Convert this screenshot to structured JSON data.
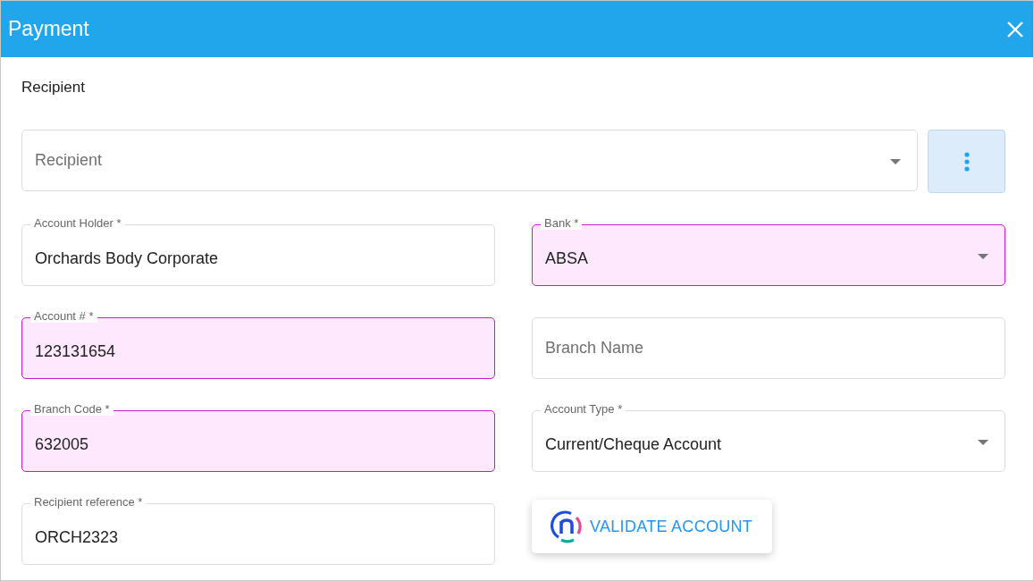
{
  "window": {
    "title": "Payment"
  },
  "section_label": "Recipient",
  "recipient_select": {
    "placeholder": "Recipient"
  },
  "fields": [
    {
      "kind": "text",
      "label": "Account Holder *",
      "value": "Orchards Body Corporate",
      "highlighted": false
    },
    {
      "kind": "select",
      "label": "Bank *",
      "value": "ABSA",
      "highlighted": true
    },
    {
      "kind": "text",
      "label": "Account # *",
      "value": "123131654",
      "highlighted": true
    },
    {
      "kind": "text",
      "placeholder": "Branch Name",
      "highlighted": false
    },
    {
      "kind": "text",
      "label": "Branch Code *",
      "value": "632005",
      "highlighted": true
    },
    {
      "kind": "select",
      "label": "Account Type *",
      "value": "Current/Cheque Account",
      "highlighted": false
    },
    {
      "kind": "text",
      "label": "Recipient reference *",
      "value": "ORCH2323",
      "highlighted": false
    },
    {
      "kind": "button",
      "label": "VALIDATE ACCOUNT"
    }
  ]
}
